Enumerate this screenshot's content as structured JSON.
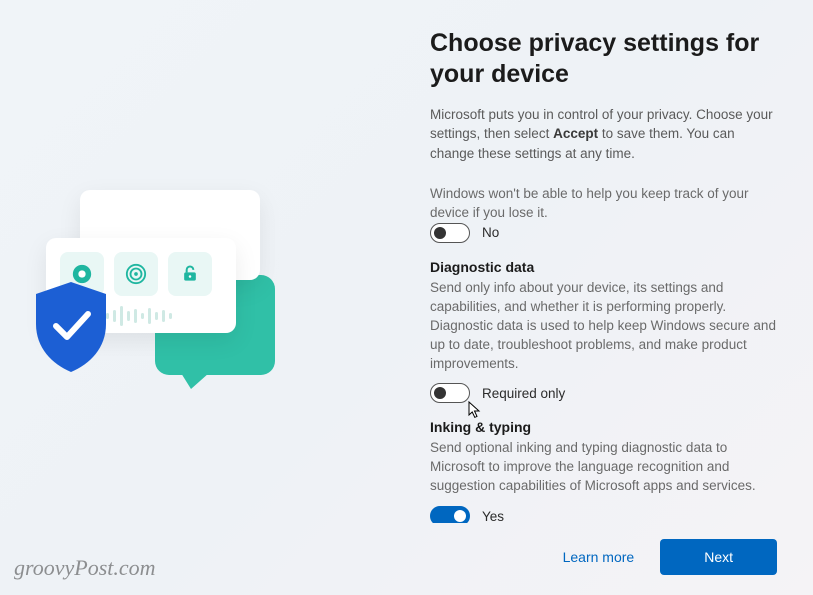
{
  "title": "Choose privacy settings for your device",
  "intro_parts": {
    "a": "Microsoft puts you in control of your privacy. Choose your settings, then select ",
    "b": "Accept",
    "c": " to save them. You can change these settings at any time."
  },
  "settings": {
    "find_device": {
      "cutoff_desc": "Windows won't be able to help you keep track of your device if you lose it.",
      "toggle_state": "off",
      "toggle_label": "No"
    },
    "diagnostic": {
      "title": "Diagnostic data",
      "desc": "Send only info about your device, its settings and capabilities, and whether it is performing properly. Diagnostic data is used to help keep Windows secure and up to date, troubleshoot problems, and make product improvements.",
      "toggle_state": "off",
      "toggle_label": "Required only"
    },
    "inking": {
      "title": "Inking & typing",
      "desc": "Send optional inking and typing diagnostic data to Microsoft to improve the language recognition and suggestion capabilities of Microsoft apps and services.",
      "toggle_state": "on",
      "toggle_label": "Yes"
    }
  },
  "footer": {
    "learn_more": "Learn more",
    "next": "Next"
  },
  "watermark": "groovyPost.com",
  "colors": {
    "accent": "#0067c0",
    "teal": "#30c0a7",
    "shield": "#1c5fd4"
  }
}
